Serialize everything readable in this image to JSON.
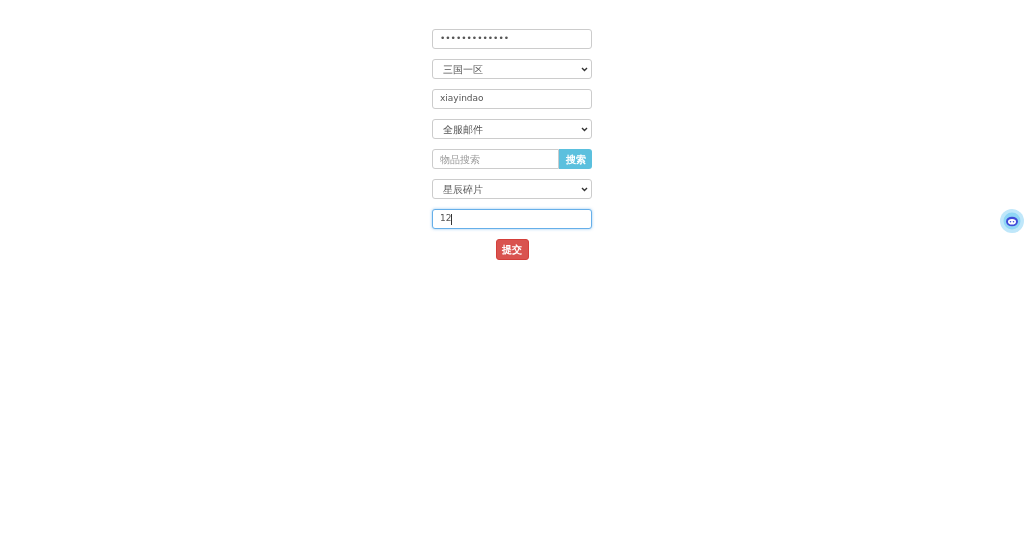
{
  "form": {
    "fields": [
      {
        "kind": "text",
        "value": "•••••••••••••",
        "focused": false
      },
      {
        "kind": "select",
        "value": "三国一区"
      },
      {
        "kind": "text",
        "value": "xiayindao",
        "focused": false
      },
      {
        "kind": "select",
        "value": "全服邮件"
      },
      {
        "kind": "search",
        "placeholder": "物品搜索",
        "button": "搜索"
      },
      {
        "kind": "select",
        "value": "星辰碎片"
      },
      {
        "kind": "text",
        "value": "12",
        "focused": true
      }
    ],
    "submit": "提交"
  }
}
